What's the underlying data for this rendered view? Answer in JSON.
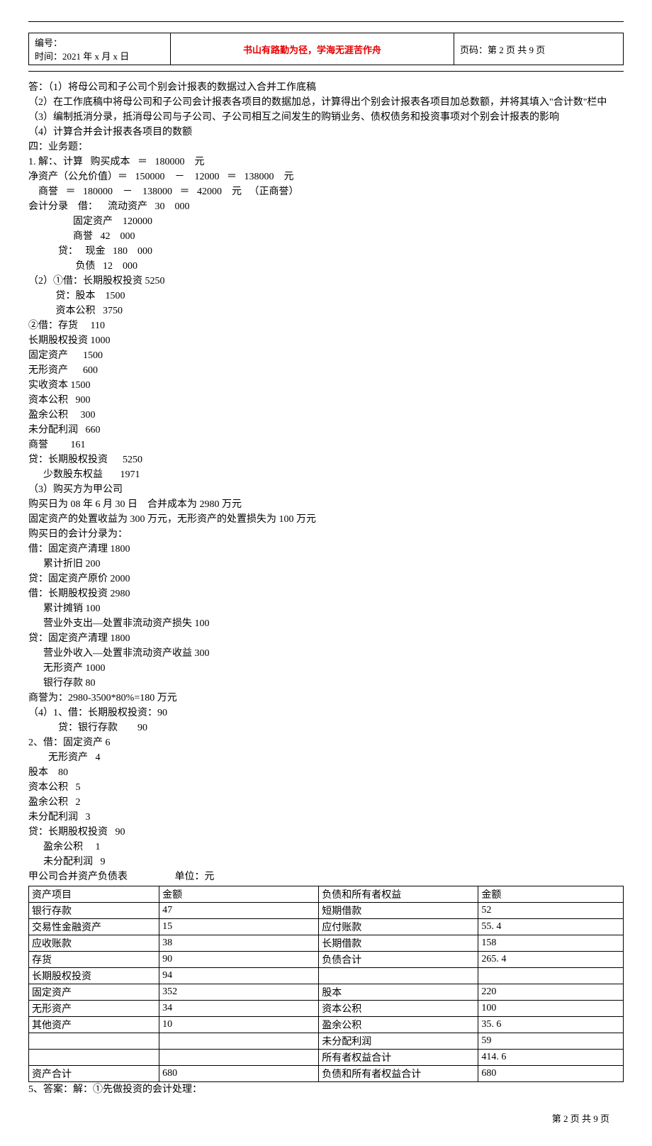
{
  "header": {
    "serial_label": "编号：",
    "time_label": "时间：2021 年 x 月 x 日",
    "center_text": "书山有路勤为径，学海无涯苦作舟",
    "page_label": "页码：第 2 页 共 9 页"
  },
  "body_lines": [
    "答：（1）将母公司和子公司个别会计报表的数据过入合并工作底稿",
    "（2）在工作底稿中将母公司和子公司会计报表各项目的数据加总，计算得出个别会计报表各项目加总数额，并将其填入\"合计数\"栏中",
    "（3）编制抵消分录，抵消母公司与子公司、子公司相互之间发生的购销业务、债权债务和投资事项对个别会计报表的影响",
    "（4）计算合并会计报表各项目的数额",
    "四：业务题：",
    "1. 解：、计算   购买成本   ＝   180000    元",
    "净资产（公允价值）＝   150000    －    12000   ＝   138000    元",
    "    商誉   ＝   180000    －    138000   ＝   42000    元   （正商誉）",
    "会计分录    借：    流动资产   30    000",
    "                  固定资产    120000",
    "                  商誉   42    000",
    "            贷：   现金   180    000",
    "                   负债   12    000",
    "（2）①借：长期股权投资 5250",
    "           贷：股本    1500",
    "           资本公积   3750",
    "②借：存货     110",
    "长期股权投资 1000",
    "固定资产      1500",
    "无形资产      600",
    "实收资本 1500",
    "资本公积   900",
    "盈余公积     300",
    "未分配利润   660",
    "商誉         161",
    "贷：长期股权投资      5250",
    "      少数股东权益       1971",
    "（3）购买方为甲公司",
    "购买日为 08 年 6 月 30 日    合并成本为 2980 万元",
    "固定资产的处置收益为 300 万元，无形资产的处置损失为 100 万元",
    "购买日的会计分录为：",
    "借：固定资产清理 1800",
    "      累计折旧 200",
    "贷：固定资产原价 2000",
    "借：长期股权投资 2980",
    "      累计摊销 100",
    "      营业外支出—处置非流动资产损失 100",
    "贷：固定资产清理 1800",
    "      营业外收入—处置非流动资产收益 300",
    "      无形资产 1000",
    "      银行存款 80",
    "商誉为：2980-3500*80%=180 万元",
    "（4）1、借：长期股权投资：90",
    "            贷：银行存款        90",
    "2、借：固定资产 6",
    "        无形资产   4",
    "股本    80",
    "资本公积   5",
    "盈余公积   2",
    "未分配利润   3",
    "贷：长期股权投资   90",
    "      盈余公积     1",
    "      未分配利润   9",
    "甲公司合并资产负债表                   单位：元"
  ],
  "balance_sheet": {
    "rows": [
      {
        "c1": "资产项目",
        "c2": "金额",
        "c3": "负债和所有者权益",
        "c4": "金额"
      },
      {
        "c1": "银行存款",
        "c2": "47",
        "c3": "短期借款",
        "c4": "52"
      },
      {
        "c1": "交易性金融资产",
        "c2": "15",
        "c3": "应付账款",
        "c4": "55. 4"
      },
      {
        "c1": "应收账款",
        "c2": "38",
        "c3": "长期借款",
        "c4": "158"
      },
      {
        "c1": "存货",
        "c2": "90",
        "c3": "负债合计",
        "c4": "265. 4"
      },
      {
        "c1": "长期股权投资",
        "c2": "94",
        "c3": "",
        "c4": ""
      },
      {
        "c1": "固定资产",
        "c2": "352",
        "c3": "股本",
        "c4": "220"
      },
      {
        "c1": "无形资产",
        "c2": "34",
        "c3": "资本公积",
        "c4": "100"
      },
      {
        "c1": "其他资产",
        "c2": "10",
        "c3": "盈余公积",
        "c4": "35. 6"
      },
      {
        "c1": "",
        "c2": "",
        "c3": "未分配利润",
        "c4": "59"
      },
      {
        "c1": "",
        "c2": "",
        "c3": "所有者权益合计",
        "c4": "414. 6"
      },
      {
        "c1": "资产合计",
        "c2": "680",
        "c3": "负债和所有者权益合计",
        "c4": "680"
      }
    ]
  },
  "after_table": "5、答案：解：①先做投资的会计处理：",
  "footer": "第 2 页 共 9 页"
}
